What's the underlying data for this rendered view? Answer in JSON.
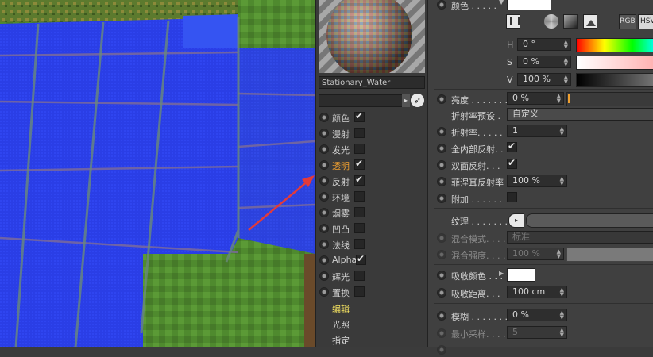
{
  "material": {
    "name": "Stationary_Water",
    "channels": [
      {
        "label": "颜色",
        "checked": true,
        "highlight": false
      },
      {
        "label": "漫射",
        "checked": false,
        "highlight": false
      },
      {
        "label": "发光",
        "checked": false,
        "highlight": false
      },
      {
        "label": "透明",
        "checked": true,
        "highlight": true
      },
      {
        "label": "反射",
        "checked": true,
        "highlight": false
      },
      {
        "label": "环境",
        "checked": false,
        "highlight": false
      },
      {
        "label": "烟雾",
        "checked": false,
        "highlight": false
      },
      {
        "label": "凹凸",
        "checked": false,
        "highlight": false
      },
      {
        "label": "法线",
        "checked": false,
        "highlight": false
      },
      {
        "label": "Alpha",
        "checked": true,
        "highlight": false
      },
      {
        "label": "辉光",
        "checked": false,
        "highlight": false
      },
      {
        "label": "置换",
        "checked": false,
        "highlight": false
      }
    ],
    "tabs": [
      "编辑",
      "光照",
      "指定"
    ]
  },
  "attributes": {
    "color_label": "颜色 . . . . .",
    "color_mode_rgb": "RGB",
    "color_mode_hsv": "HSV",
    "h": {
      "label": "H",
      "value": "0 °"
    },
    "s": {
      "label": "S",
      "value": "0 %"
    },
    "v": {
      "label": "V",
      "value": "100 %"
    },
    "brightness": {
      "label": "亮度 . . . . . . .",
      "value": "0 %"
    },
    "refraction_preset": {
      "label": "折射率预设 .",
      "value": "自定义"
    },
    "refraction": {
      "label": "折射率. . . . .",
      "value": "1"
    },
    "total_internal": {
      "label": "全内部反射. .",
      "checked": true
    },
    "double_sided": {
      "label": "双面反射. . .",
      "checked": true
    },
    "fresnel": {
      "label": "菲涅耳反射率",
      "value": "100 %"
    },
    "additive": {
      "label": "附加 . . . . . .",
      "checked": false
    },
    "texture": {
      "label": "纹理 . . . . . . ."
    },
    "blend_mode": {
      "label": "混合模式. . . .",
      "value": "标准"
    },
    "blend_strength": {
      "label": "混合强度. . . .",
      "value": "100 %"
    },
    "absorption_color": {
      "label": "吸收颜色 . . ."
    },
    "absorption_distance": {
      "label": "吸收距离. . .",
      "value": "100 cm"
    },
    "blur": {
      "label": "模糊 . . . . . . .",
      "value": "0 %"
    },
    "min_samples": {
      "label": "最小采样. . . .",
      "value": "5"
    }
  },
  "colors": {
    "accent": "#f0a030",
    "active_tab": "#f2e060",
    "water_blue": "#2a3dea",
    "annotation_arrow": "#e23a3a"
  }
}
